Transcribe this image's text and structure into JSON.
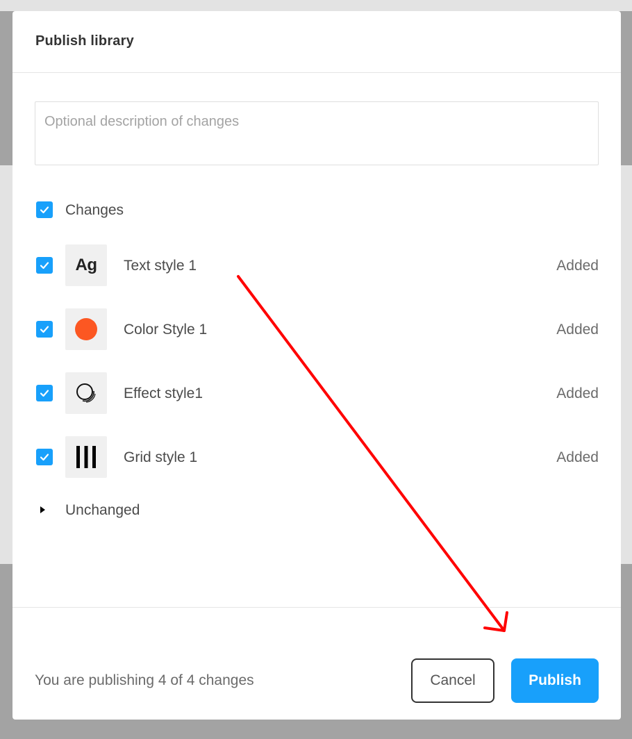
{
  "dialog": {
    "title": "Publish library",
    "description_placeholder": "Optional description of changes"
  },
  "changes": {
    "label": "Changes",
    "checked": true,
    "items": [
      {
        "name": "Text style 1",
        "status": "Added",
        "checked": true,
        "thumb": "text-style-icon",
        "thumb_text": "Ag"
      },
      {
        "name": "Color Style 1",
        "status": "Added",
        "checked": true,
        "thumb": "color-dot-icon",
        "color": "#fc5722"
      },
      {
        "name": "Effect style1",
        "status": "Added",
        "checked": true,
        "thumb": "effect-style-icon"
      },
      {
        "name": "Grid style 1",
        "status": "Added",
        "checked": true,
        "thumb": "grid-columns-icon"
      }
    ]
  },
  "unchanged": {
    "label": "Unchanged",
    "expanded": false
  },
  "footer": {
    "summary": "You are publishing 4 of 4 changes",
    "cancel_label": "Cancel",
    "publish_label": "Publish"
  },
  "colors": {
    "accent": "#18a0fb",
    "annotation_arrow": "#ff0000"
  }
}
